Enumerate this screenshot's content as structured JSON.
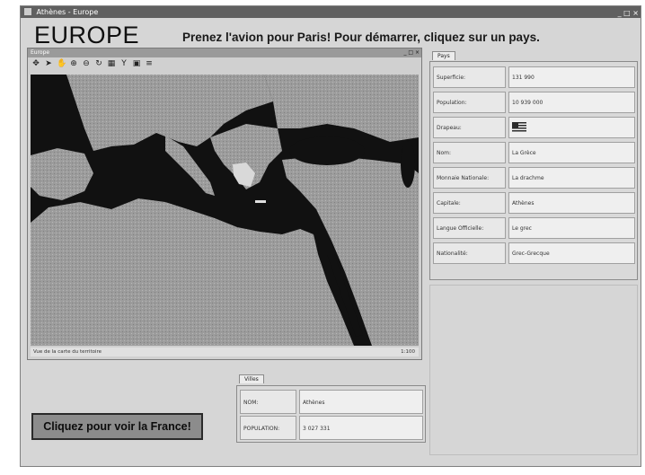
{
  "window": {
    "title": "Athènes - Europe",
    "controls": "_ □ ×"
  },
  "header": {
    "app_title": "EUROPE",
    "instruction": "Prenez l'avion pour Paris! Pour démarrer, cliquez sur un pays."
  },
  "map_window": {
    "title": "Europe",
    "controls": "_ □ ×",
    "toolbar_icons": [
      "pan-icon",
      "pointer-icon",
      "hand-icon",
      "zoom-in-icon",
      "zoom-out-icon",
      "refresh-icon",
      "grid-icon",
      "filter-icon",
      "legend-icon",
      "list-icon"
    ],
    "status_text": "Vue de la carte du territoire",
    "zoom_text": "1:100"
  },
  "country_panel": {
    "tab_label": "Pays",
    "rows": [
      {
        "label": "Superficie:",
        "value": "131 990"
      },
      {
        "label": "Population:",
        "value": "10 939 000"
      },
      {
        "label": "Drapeau:",
        "value": ""
      },
      {
        "label": "Nom:",
        "value": "La Grèce"
      },
      {
        "label": "Monnaie Nationale:",
        "value": "La drachme"
      },
      {
        "label": "Capitale:",
        "value": "Athènes"
      },
      {
        "label": "Langue Officielle:",
        "value": "Le grec"
      },
      {
        "label": "Nationalité:",
        "value": "Grec-Grecque"
      }
    ]
  },
  "city_panel": {
    "tab_label": "Villes",
    "rows": [
      {
        "label": "NOM:",
        "value": "Athènes"
      },
      {
        "label": "POPULATION:",
        "value": "3 027 331"
      }
    ]
  },
  "france_button": {
    "label": "Cliquez pour voir la France!"
  },
  "colors": {
    "background": "#d6d6d6",
    "sea": "#111111",
    "land": "#9a9a9a",
    "button": "#8c8c8c"
  }
}
